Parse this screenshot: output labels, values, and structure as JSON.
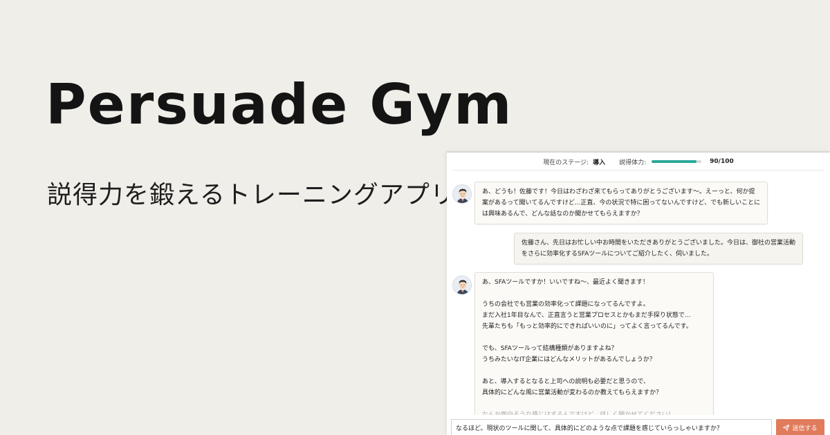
{
  "hero": {
    "title": "Persuade Gym",
    "subtitle": "説得力を鍛えるトレーニングアプリ"
  },
  "status": {
    "stage_label": "現在のステージ:",
    "stage_value": "導入",
    "stamina_label": "説得体力:",
    "stamina_value": "90/100",
    "stamina_fraction": 0.9,
    "stamina_color": "#2aa99a"
  },
  "messages": [
    {
      "role": "bot",
      "lines": [
        "あ、どうも！佐藤です！今日はわざわざ来てもらってありがとうございます〜。えーっと、何か提",
        "案があるって聞いてるんですけど...正直、今の状況で特に困ってないんですけど、でも新しいことに",
        "は興味あるんで、どんな話なのか聞かせてもらえますか？"
      ]
    },
    {
      "role": "user",
      "lines": [
        "佐藤さん、先日はお忙しい中お時間をいただきありがとうございました。今日は、御社の営業活動",
        "をさらに効率化するSFAツールについてご紹介したく、伺いました。"
      ]
    },
    {
      "role": "bot",
      "lines": [
        "あ、SFAツールですか！いいですね〜、最近よく聞きます！",
        "",
        "うちの会社でも営業の効率化って課題になってるんですよ。",
        "まだ入社1年目なんで、正直言うと営業プロセスとかもまだ手探り状態で...",
        "先輩たちも「もっと効率的にできればいいのに」ってよく言ってるんです。",
        "",
        "でも、SFAツールって結構種類がありますよね？",
        "うちみたいなIT企業にはどんなメリットがあるんでしょうか？",
        "",
        "あと、導入するとなると上司への説明も必要だと思うので、",
        "具体的にどんな風に営業活動が変わるのか教えてもらえますか？",
        "",
        "なんか面白そうな感じはするんですけど、詳しく聞かせてください！"
      ]
    }
  ],
  "input": {
    "value": "なるほど。現状のツールに関して、具体的にどのような点で課題を感じていらっしゃいますか？"
  },
  "send": {
    "label": "送信する",
    "icon": "paper-plane-icon",
    "color": "#e07b5c"
  }
}
